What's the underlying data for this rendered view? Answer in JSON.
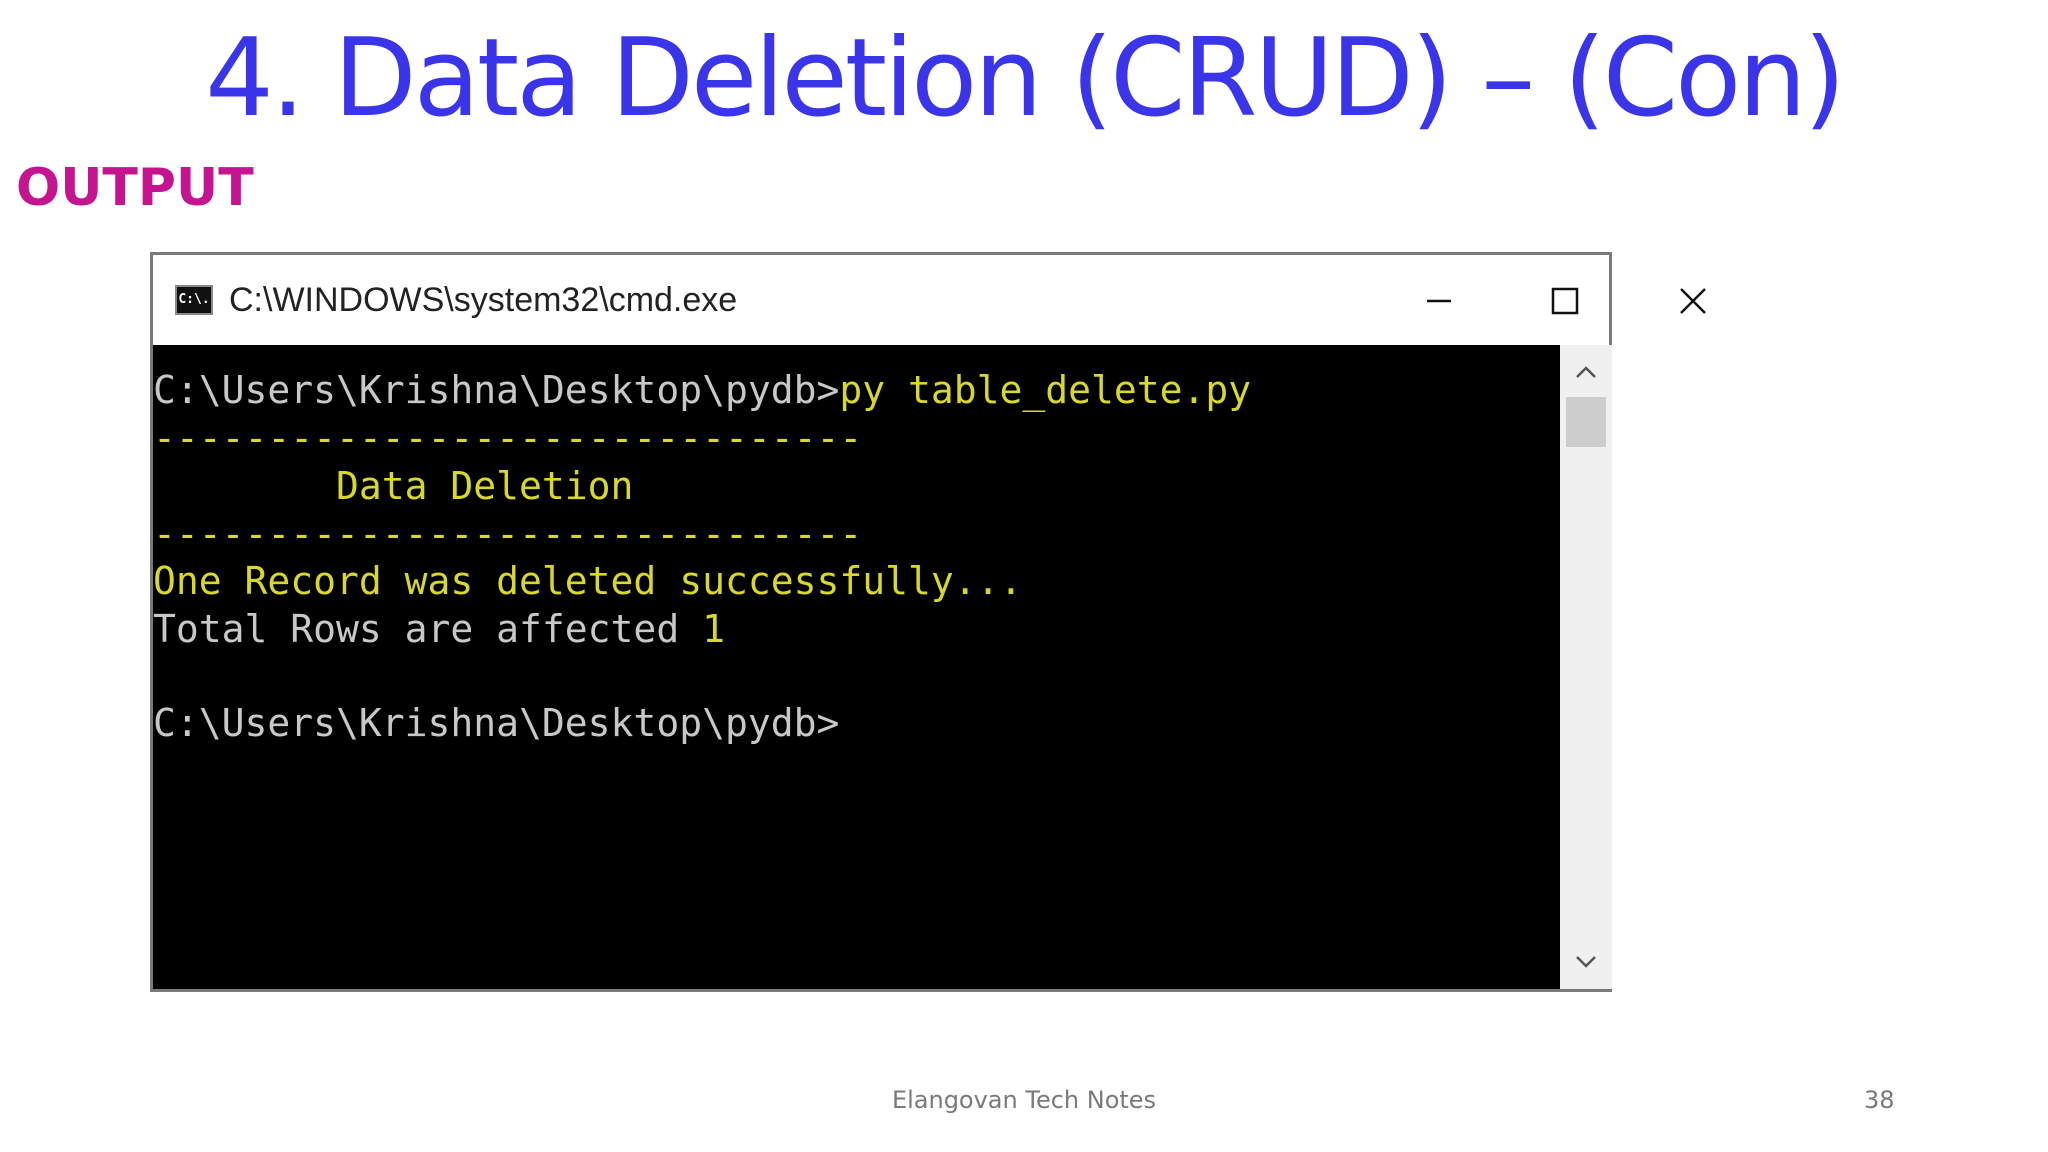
{
  "slide": {
    "title": "4. Data Deletion (CRUD) – (Con)",
    "section_label": "OUTPUT",
    "footer": "Elangovan Tech Notes",
    "page_number": "38"
  },
  "window": {
    "icon_text": "C:\\.",
    "title": "C:\\WINDOWS\\system32\\cmd.exe",
    "controls": {
      "minimize": "minimize-icon",
      "maximize": "maximize-icon",
      "close": "close-icon"
    }
  },
  "console": {
    "prompt1": "C:\\Users\\Krishna\\Desktop\\pydb>",
    "command1": "py table_delete.py",
    "divider_top": "-------------------------------",
    "heading": "        Data Deletion",
    "divider_bottom": "-------------------------------",
    "success_message": "One Record was deleted successfully...",
    "rows_label": "Total Rows are affected ",
    "rows_value": "1",
    "prompt2": "C:\\Users\\Krishna\\Desktop\\pydb>"
  },
  "colors": {
    "title": "#3a35e8",
    "section_label": "#c4148f",
    "console_bg": "#000000",
    "console_text": "#c8c8c8",
    "console_highlight": "#d8d82c"
  }
}
